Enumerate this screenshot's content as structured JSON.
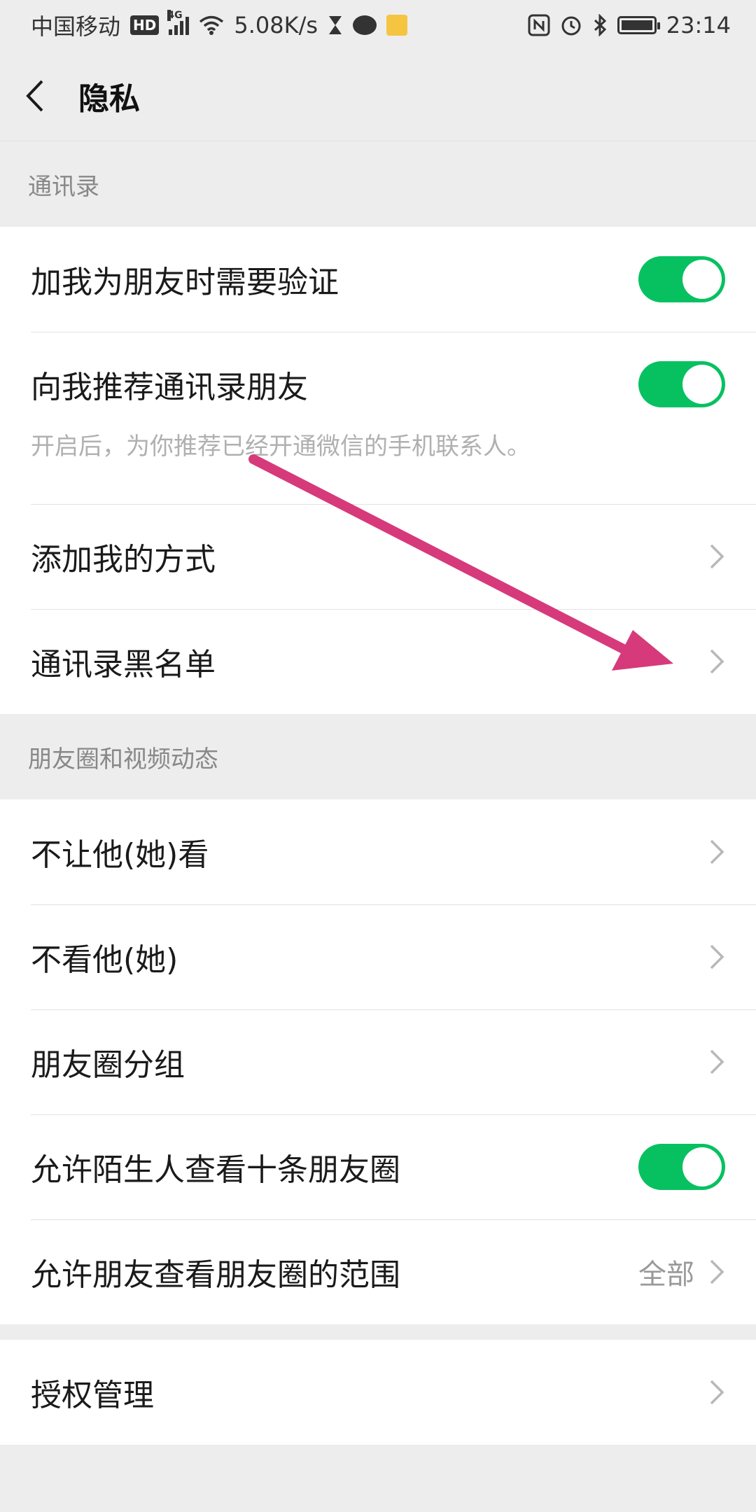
{
  "status_bar": {
    "carrier": "中国移动",
    "hd_badge": "HD",
    "network_type": "4G",
    "net_speed": "5.08K/s",
    "time": "23:14",
    "icons": [
      "hd-icon",
      "signal-icon",
      "wifi-icon",
      "hourglass-icon",
      "chat-icon",
      "news-icon",
      "nfc-icon",
      "alarm-icon",
      "bluetooth-icon",
      "battery-icon"
    ]
  },
  "nav": {
    "title": "隐私",
    "back_icon": "chevron-left-icon"
  },
  "sections": {
    "contacts": {
      "header": "通讯录",
      "items": {
        "verify": {
          "label": "加我为朋友时需要验证",
          "toggle_on": true
        },
        "recommend": {
          "label": "向我推荐通讯录朋友",
          "desc": "开启后，为你推荐已经开通微信的手机联系人。",
          "toggle_on": true
        },
        "add_methods": {
          "label": "添加我的方式"
        },
        "blacklist": {
          "label": "通讯录黑名单"
        }
      }
    },
    "moments": {
      "header": "朋友圈和视频动态",
      "items": {
        "hide_from": {
          "label": "不让他(她)看"
        },
        "dont_see": {
          "label": "不看他(她)"
        },
        "groups": {
          "label": "朋友圈分组"
        },
        "strangers_ten": {
          "label": "允许陌生人查看十条朋友圈",
          "toggle_on": true
        },
        "range": {
          "label": "允许朋友查看朋友圈的范围",
          "value": "全部"
        }
      }
    },
    "auth": {
      "items": {
        "manage": {
          "label": "授权管理"
        }
      }
    }
  },
  "colors": {
    "toggle_on": "#07c160",
    "annotation_arrow": "#d63a7a",
    "background": "#ededed"
  }
}
